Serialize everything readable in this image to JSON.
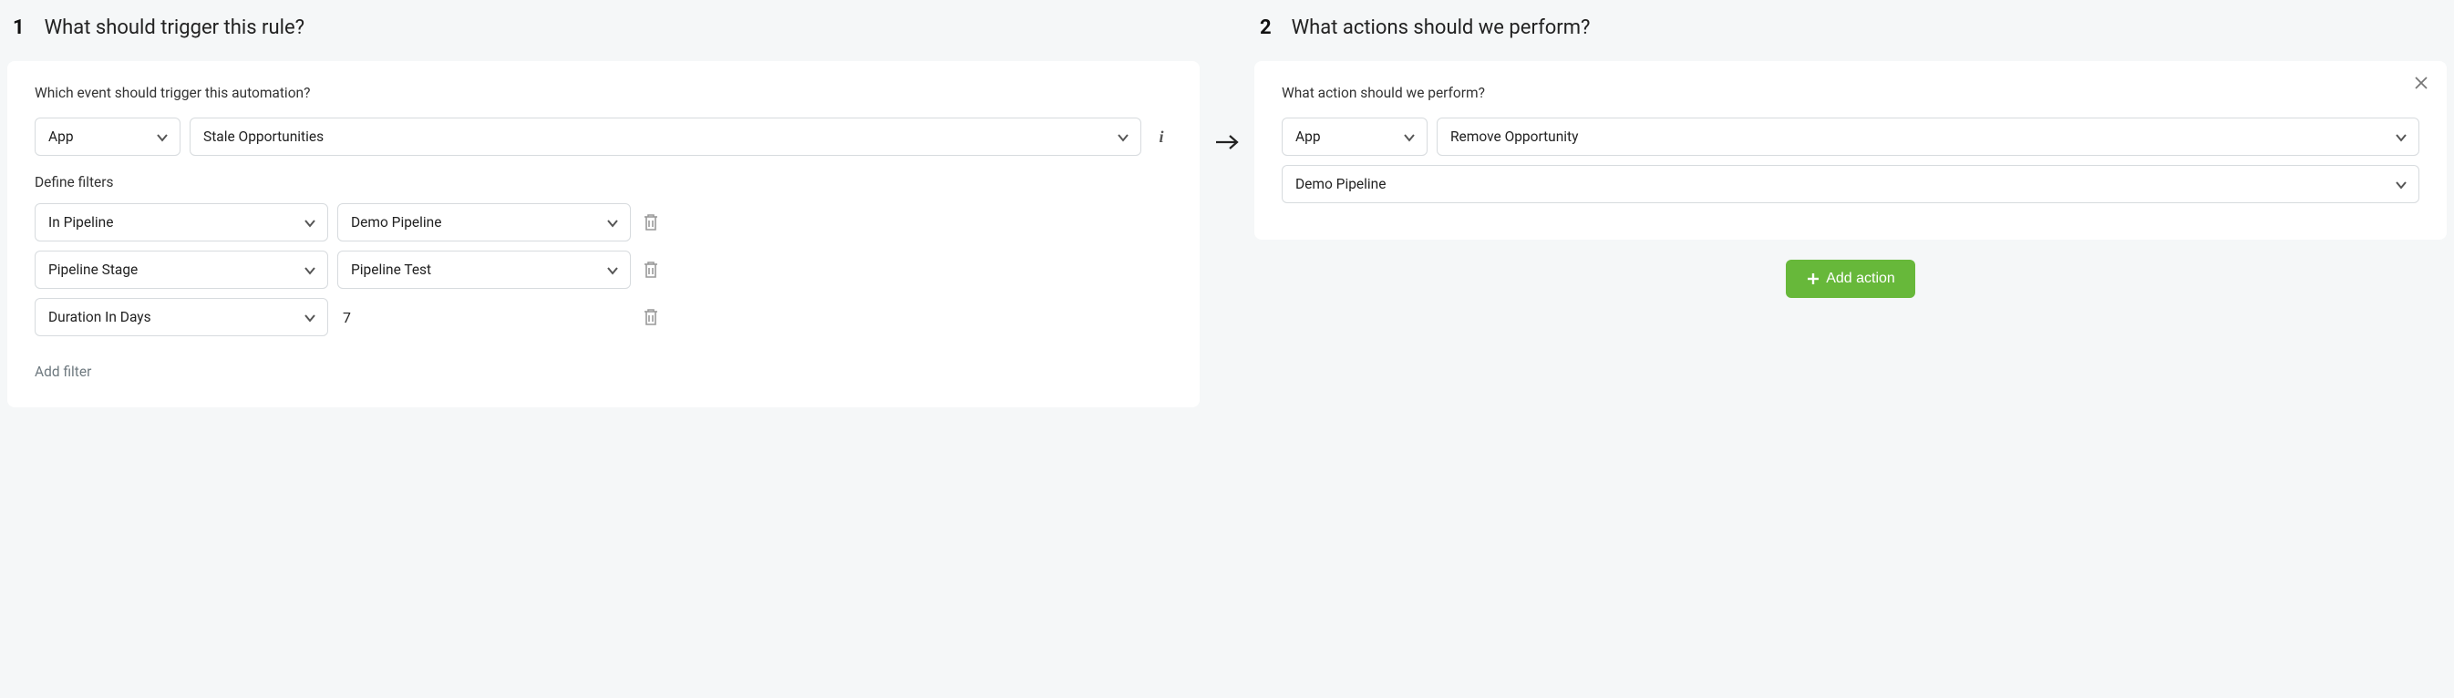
{
  "trigger": {
    "step_num": "1",
    "title": "What should trigger this rule?",
    "question": "Which event should trigger this automation?",
    "source_type": "App",
    "event": "Stale Opportunities",
    "filters_label": "Define filters",
    "filters": [
      {
        "field": "In Pipeline",
        "value": "Demo Pipeline",
        "value_is_select": true
      },
      {
        "field": "Pipeline Stage",
        "value": "Pipeline Test",
        "value_is_select": true
      },
      {
        "field": "Duration In Days",
        "value": "7",
        "value_is_select": false
      }
    ],
    "add_filter_label": "Add filter"
  },
  "action": {
    "step_num": "2",
    "title": "What actions should we perform?",
    "question": "What action should we perform?",
    "source_type": "App",
    "action_name": "Remove Opportunity",
    "target": "Demo Pipeline",
    "add_action_label": "Add action"
  }
}
